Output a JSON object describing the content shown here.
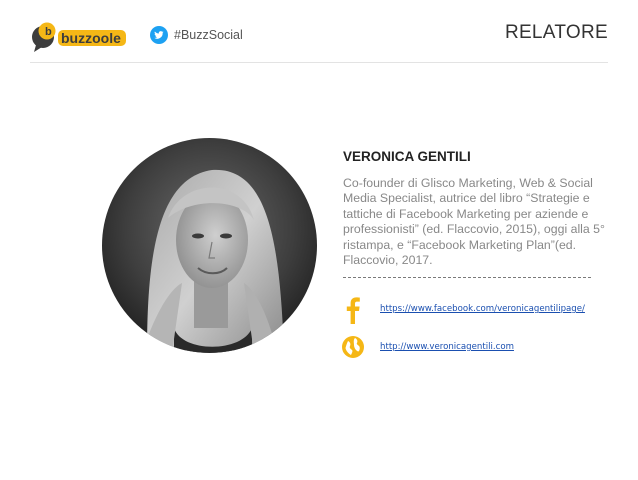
{
  "header": {
    "brand": "buzzoole",
    "hashtag": "#BuzzSocial",
    "title": "RELATORE"
  },
  "speaker": {
    "name": "VERONICA GENTILI",
    "bio": "Co-founder di Glisco Marketing, Web & Social Media Specialist, autrice del libro “Strategie e tattiche di Facebook Marketing per aziende e professionisti” (ed. Flaccovio, 2015), oggi alla 5° ristampa, e “Facebook Marketing Plan”(ed. Flaccovio, 2017."
  },
  "links": {
    "facebook": "https://www.facebook.com/veronicagentilipage/",
    "website": "http://www.veronicagentili.com"
  },
  "icons": {
    "brand_logo": "buzzoole-logo",
    "hashtag_icon": "twitter-icon",
    "facebook_icon": "facebook-icon",
    "website_icon": "globe-icon"
  },
  "colors": {
    "accent": "#f5b716",
    "logo_dark": "#3d3d3d",
    "twitter": "#1da1f2",
    "link": "#1a4fb0"
  }
}
